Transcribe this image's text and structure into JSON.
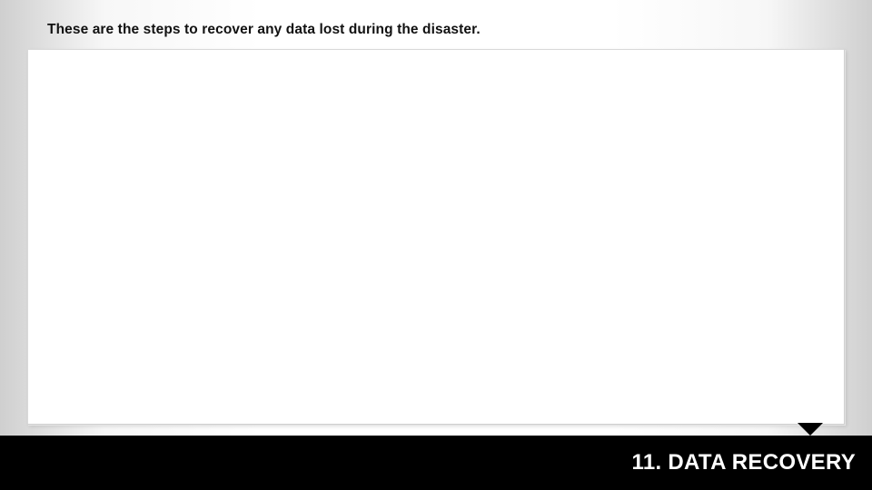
{
  "intro_text": "These are the steps to recover any data lost during the disaster.",
  "footer": {
    "title": "11. DATA RECOVERY"
  }
}
